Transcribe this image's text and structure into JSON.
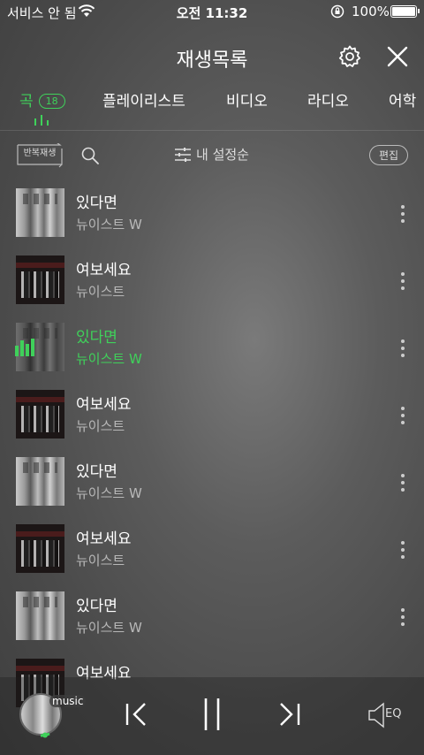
{
  "status_bar": {
    "carrier": "서비스 안 됨",
    "time": "오전 11:32",
    "battery": "100%"
  },
  "header": {
    "title": "재생목록"
  },
  "tabs": [
    {
      "label": "곡",
      "count": "18",
      "active": true
    },
    {
      "label": "플레이리스트"
    },
    {
      "label": "비디오"
    },
    {
      "label": "라디오"
    },
    {
      "label": "어학"
    }
  ],
  "toolbar": {
    "repeat_label": "반복재생",
    "sort_label": "내 설정순",
    "edit_label": "편집"
  },
  "songs": [
    {
      "title": "있다면",
      "artist": "뉴이스트 W",
      "cover": "bw"
    },
    {
      "title": "여보세요",
      "artist": "뉴이스트",
      "cover": "dark"
    },
    {
      "title": "있다면",
      "artist": "뉴이스트 W",
      "cover": "bw",
      "playing": true
    },
    {
      "title": "여보세요",
      "artist": "뉴이스트",
      "cover": "dark"
    },
    {
      "title": "있다면",
      "artist": "뉴이스트 W",
      "cover": "bw"
    },
    {
      "title": "여보세요",
      "artist": "뉴이스트",
      "cover": "dark"
    },
    {
      "title": "있다면",
      "artist": "뉴이스트 W",
      "cover": "bw"
    },
    {
      "title": "여보세요",
      "artist": "",
      "cover": "dark"
    }
  ],
  "player": {
    "badge": "music",
    "eq_label": "EQ",
    "accent": "#3fd15a"
  }
}
